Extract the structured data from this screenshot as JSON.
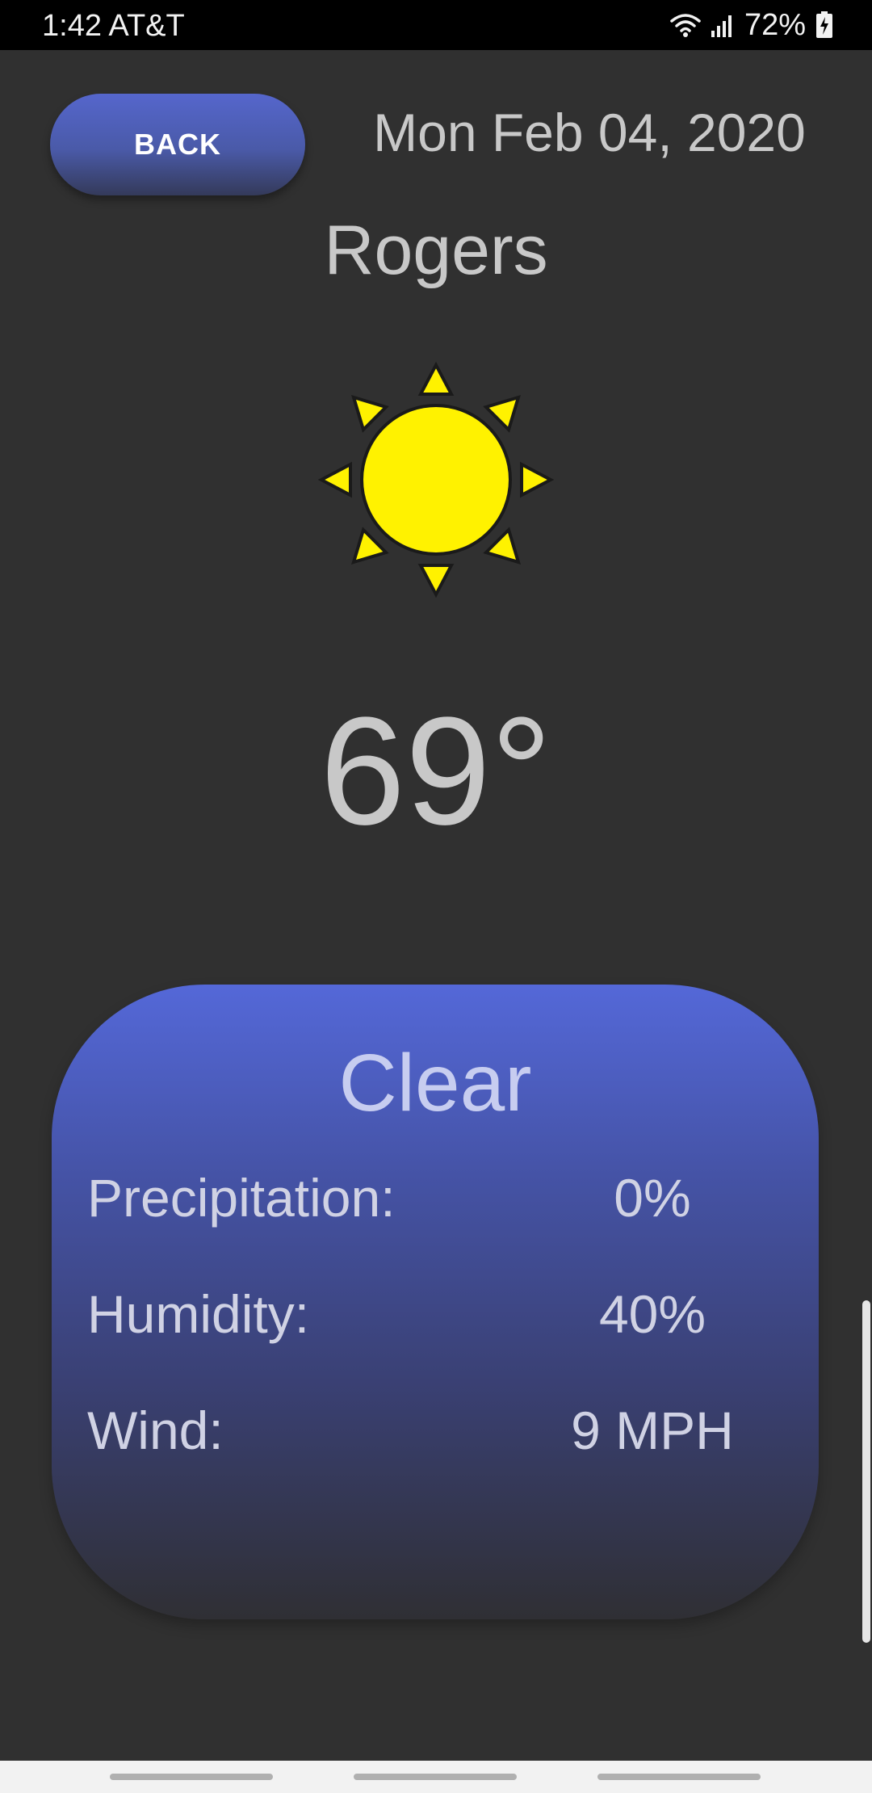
{
  "status_bar": {
    "time_carrier": "1:42 AT&T",
    "battery_percent": "72%",
    "icons": [
      "wifi-icon",
      "signal-icon",
      "battery-charging-icon"
    ]
  },
  "header": {
    "back_label": "BACK",
    "date": "Mon Feb 04, 2020"
  },
  "location": {
    "city": "Rogers"
  },
  "weather": {
    "icon": "sun-icon",
    "temperature": "69°",
    "condition": "Clear",
    "stats": [
      {
        "label": "Precipitation:",
        "value": "0%"
      },
      {
        "label": "Humidity:",
        "value": "40%"
      },
      {
        "label": "Wind:",
        "value": "9 MPH"
      }
    ]
  },
  "colors": {
    "background": "#303030",
    "accent": "#5468d8",
    "sun": "#fff200",
    "text": "#c8c8c8"
  }
}
